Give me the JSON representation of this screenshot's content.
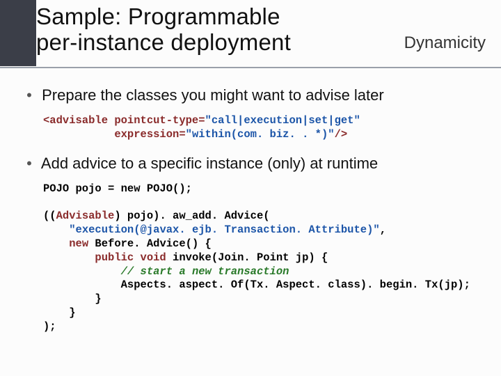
{
  "header": {
    "title_line1": "Sample: Programmable",
    "title_line2": "per-instance deployment",
    "subtitle": "Dynamicity"
  },
  "bullets": {
    "b1": "Prepare the classes you might want to advise later",
    "b2": "Add advice to a specific instance (only) at runtime"
  },
  "code1": {
    "l1a": "<advisable pointcut-type=",
    "l1b": "\"call|execution|set|get\"",
    "l2a": "           expression=",
    "l2b": "\"within(com. biz. . *)\"",
    "l2c": "/>"
  },
  "code2": {
    "l1": "POJO pojo = new POJO();",
    "blank": "",
    "l3a": "((",
    "l3b": "Advisable",
    "l3c": ") pojo). aw_add. Advice(",
    "l4a": "    ",
    "l4b": "\"execution(@javax. ejb. Transaction. Attribute)\"",
    "l4c": ",",
    "l5a": "    ",
    "l5b": "new",
    "l5c": " Before. Advice() {",
    "l6a": "        ",
    "l6b": "public void",
    "l6c": " invoke(Join. Point jp) {",
    "l7a": "            ",
    "l7b": "// start a new transaction",
    "l8": "            Aspects. aspect. Of(Tx. Aspect. class). begin. Tx(jp);",
    "l9": "        }",
    "l10": "    }",
    "l11": ");"
  }
}
